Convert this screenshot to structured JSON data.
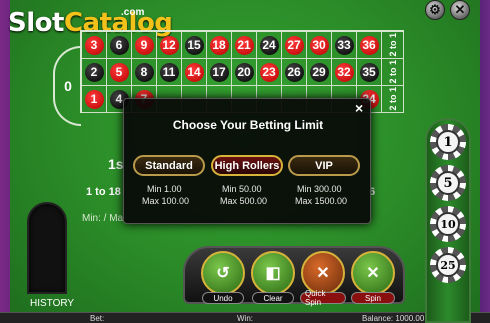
{
  "logo": {
    "slot": "Slot",
    "catalog": "Catalog",
    "com": ".com"
  },
  "top_controls": {
    "settings_glyph": "⚙",
    "close_glyph": "✕"
  },
  "table": {
    "zero": "0",
    "rows": [
      [
        {
          "n": "3",
          "c": "red"
        },
        {
          "n": "6",
          "c": "black"
        },
        {
          "n": "9",
          "c": "red"
        },
        {
          "n": "12",
          "c": "red"
        },
        {
          "n": "15",
          "c": "black"
        },
        {
          "n": "18",
          "c": "red"
        },
        {
          "n": "21",
          "c": "red"
        },
        {
          "n": "24",
          "c": "black"
        },
        {
          "n": "27",
          "c": "red"
        },
        {
          "n": "30",
          "c": "red"
        },
        {
          "n": "33",
          "c": "black"
        },
        {
          "n": "36",
          "c": "red"
        }
      ],
      [
        {
          "n": "2",
          "c": "black"
        },
        {
          "n": "5",
          "c": "red"
        },
        {
          "n": "8",
          "c": "black"
        },
        {
          "n": "11",
          "c": "black"
        },
        {
          "n": "14",
          "c": "red"
        },
        {
          "n": "17",
          "c": "black"
        },
        {
          "n": "20",
          "c": "black"
        },
        {
          "n": "23",
          "c": "red"
        },
        {
          "n": "26",
          "c": "black"
        },
        {
          "n": "29",
          "c": "black"
        },
        {
          "n": "32",
          "c": "red"
        },
        {
          "n": "35",
          "c": "black"
        }
      ],
      [
        {
          "n": "1",
          "c": "red"
        },
        {
          "n": "4",
          "c": "black"
        },
        {
          "n": "7",
          "c": "red"
        },
        {
          "n": "",
          "c": ""
        },
        {
          "n": "",
          "c": ""
        },
        {
          "n": "",
          "c": ""
        },
        {
          "n": "",
          "c": ""
        },
        {
          "n": "",
          "c": ""
        },
        {
          "n": "",
          "c": ""
        },
        {
          "n": "",
          "c": ""
        },
        {
          "n": "",
          "c": ""
        },
        {
          "n": "34",
          "c": "red"
        }
      ]
    ],
    "column_bets": [
      "2 to 1",
      "2 to 1",
      "2 to 1"
    ],
    "dozen_first_visible": "1s",
    "low_bet": "1 to 18",
    "six_fragment": "6",
    "min_max_label": "Min: / Ma"
  },
  "history_label": "HISTORY",
  "controls": {
    "undo": "Undo",
    "clear": "Clear",
    "quick_spin": "Quick Spin",
    "spin": "Spin"
  },
  "status_bar": {
    "bet": "Bet:",
    "win": "Win:",
    "balance": "Balance: 1000.00"
  },
  "chips": [
    "1",
    "5",
    "10",
    "25"
  ],
  "modal": {
    "title": "Choose Your Betting Limit",
    "close": "×",
    "options": [
      {
        "label": "Standard",
        "min": "Min 1.00",
        "max": "Max 100.00",
        "selected": false
      },
      {
        "label": "High Rollers",
        "min": "Min 50.00",
        "max": "Max 500.00",
        "selected": true
      },
      {
        "label": "VIP",
        "min": "Min 300.00",
        "max": "Max 1500.00",
        "selected": false
      }
    ]
  }
}
